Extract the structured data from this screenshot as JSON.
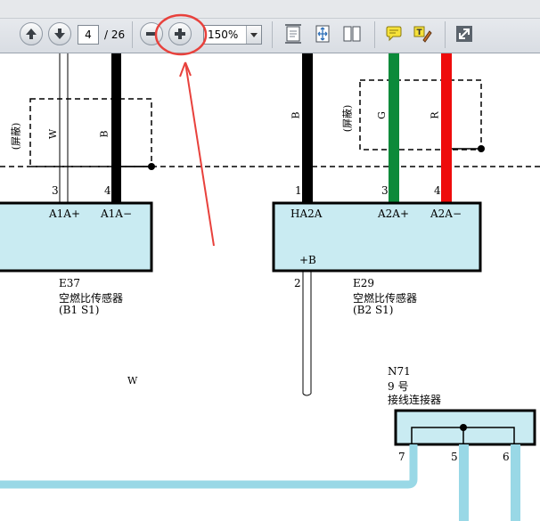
{
  "toolbar": {
    "page_current": "4",
    "page_total": "/ 26",
    "zoom": "150%"
  },
  "diagram": {
    "shield_label": "(屏蔽)",
    "wire_w": "W",
    "wire_b": "B",
    "wire_g": "G",
    "wire_r": "R",
    "pin_3": "3",
    "pin_4": "4",
    "pin_1": "1",
    "pin_2": "2",
    "pin_7": "7",
    "pin_5": "5",
    "pin_6": "6",
    "e37_pin_a": "A1A+",
    "e37_pin_b": "A1A−",
    "e29_pin_ha": "HA2A",
    "e29_pin_a": "A2A+",
    "e29_pin_b": "A2A−",
    "e29_pin_pb": "+B",
    "e37_id": "E37",
    "e37_name": "空燃比传感器",
    "e37_pos": "(B1 S1)",
    "e29_id": "E29",
    "e29_name": "空燃比传感器",
    "e29_pos": "(B2 S1)",
    "n71_id": "N71",
    "n71_num": "9 号",
    "n71_name": "接线连接器",
    "mid_w": "W"
  },
  "colors": {
    "connector_fill": "#c9ebf2",
    "wire_green": "#0c8a3a",
    "wire_red": "#ee0c0c",
    "wire_lightblue": "#99d8e6",
    "annotation_red": "#e8413c"
  }
}
